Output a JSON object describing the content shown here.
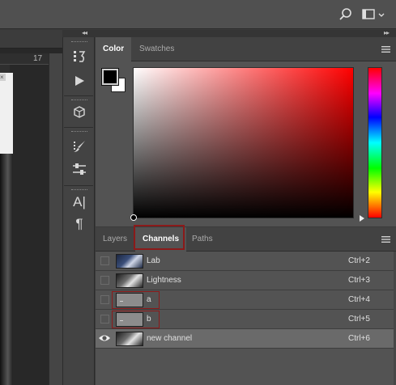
{
  "topbar": {
    "search_icon": "search-icon",
    "workspace_icon": "workspace-switcher-icon"
  },
  "document": {
    "ruler_label": "17"
  },
  "panel_collapse": {
    "left": "◂◂",
    "right": "▸▸"
  },
  "tools": [
    {
      "name": "history-icon",
      "glyph": "⌛"
    },
    {
      "name": "actions-play-icon",
      "glyph": "▶"
    },
    {
      "name": "3d-icon",
      "glyph": "◈"
    },
    {
      "name": "brush-settings-icon",
      "glyph": "✎"
    },
    {
      "name": "adjustments-icon",
      "glyph": "⚟"
    },
    {
      "name": "character-icon",
      "glyph": "A|"
    },
    {
      "name": "paragraph-icon",
      "glyph": "¶"
    }
  ],
  "color_panel": {
    "tabs": [
      "Color",
      "Swatches"
    ],
    "active_tab": "Color",
    "foreground": "#000000",
    "background": "#ffffff",
    "hue": "#ff0000"
  },
  "channels_panel": {
    "tabs": [
      "Layers",
      "Channels",
      "Paths"
    ],
    "active_tab": "Channels",
    "rows": [
      {
        "name": "Lab",
        "shortcut": "Ctrl+2",
        "visible": false,
        "selected": false
      },
      {
        "name": "Lightness",
        "shortcut": "Ctrl+3",
        "visible": false,
        "selected": false
      },
      {
        "name": "a",
        "shortcut": "Ctrl+4",
        "visible": false,
        "selected": false
      },
      {
        "name": "b",
        "shortcut": "Ctrl+5",
        "visible": false,
        "selected": false
      },
      {
        "name": "new channel",
        "shortcut": "Ctrl+6",
        "visible": true,
        "selected": true
      }
    ]
  },
  "colors": {
    "highlight_outline": "#8b1a1a",
    "selected_row": "#6a6a6a"
  }
}
